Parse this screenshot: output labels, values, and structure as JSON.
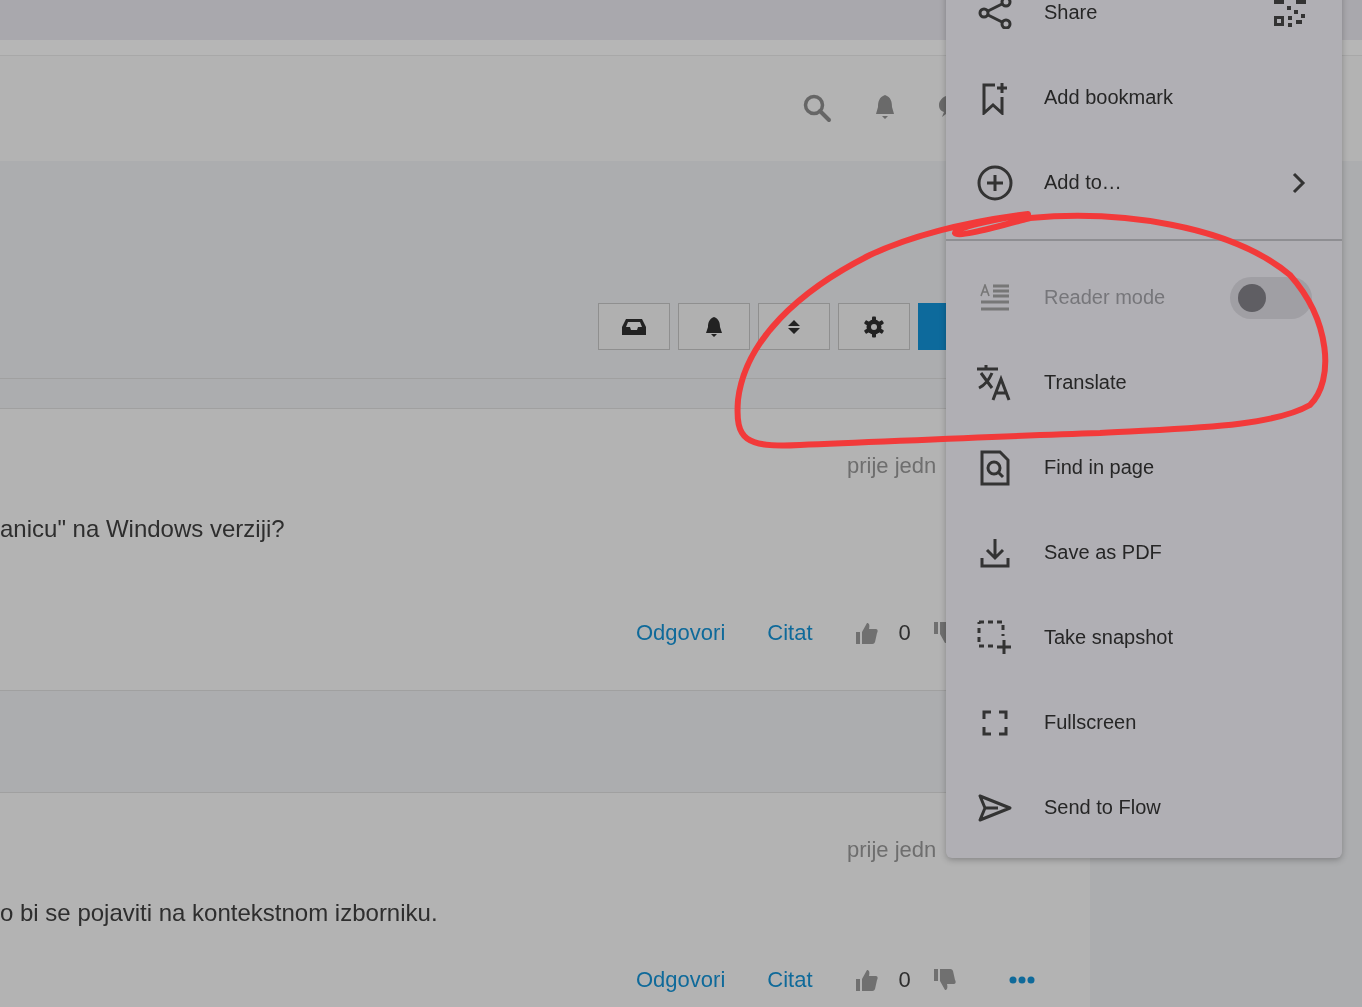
{
  "posts": [
    {
      "time": "prije jedn",
      "text": "anicu\" na Windows verziji?",
      "reply": "Odgovori",
      "quote": "Citat",
      "likes": "0",
      "show_more": false
    },
    {
      "time": "prije jedn",
      "text": "o bi se pojaviti na kontekstnom izborniku.",
      "reply": "Odgovori",
      "quote": "Citat",
      "likes": "0",
      "show_more": true
    }
  ],
  "menu": {
    "items": [
      {
        "kind": "item",
        "label": "Share",
        "disabled": false
      },
      {
        "kind": "item",
        "label": "Add bookmark",
        "disabled": false
      },
      {
        "kind": "submenu",
        "label": "Add to…",
        "disabled": false
      },
      {
        "kind": "toggle",
        "label": "Reader mode",
        "disabled": true,
        "on": false
      },
      {
        "kind": "item",
        "label": "Translate",
        "disabled": false
      },
      {
        "kind": "item",
        "label": "Find in page",
        "disabled": false
      },
      {
        "kind": "item",
        "label": "Save as PDF",
        "disabled": false
      },
      {
        "kind": "item",
        "label": "Take snapshot",
        "disabled": false
      },
      {
        "kind": "item",
        "label": "Fullscreen",
        "disabled": false
      },
      {
        "kind": "item",
        "label": "Send to Flow",
        "disabled": false
      }
    ]
  }
}
